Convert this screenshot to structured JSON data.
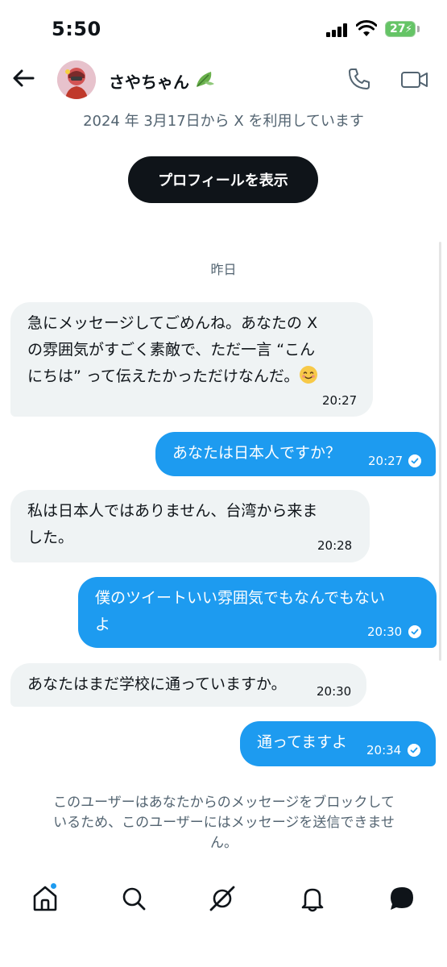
{
  "status_bar": {
    "time": "5:50",
    "battery": "27"
  },
  "header": {
    "contact_name": "さやちゃん"
  },
  "joined_text": "2024 年 3月17日から X を利用しています",
  "profile_button": "プロフィールを表示",
  "date_separator": "昨日",
  "messages": [
    {
      "direction": "in",
      "lines": [
        "急にメッセージしてごめんね。あなたの X",
        "の雰囲気がすごく素敵で、ただ一言 “こん",
        "にちは” って伝えたかっただけなんだ。"
      ],
      "time": "20:27"
    },
    {
      "direction": "out",
      "lines": [
        "あなたは日本人ですか？"
      ],
      "time": "20:27",
      "read": true
    },
    {
      "direction": "in",
      "lines": [
        "私は日本人ではありません、台湾から来ま",
        "した。"
      ],
      "time": "20:28"
    },
    {
      "direction": "out",
      "lines": [
        "僕のツイートいい雰囲気でもなんでもない",
        "よ"
      ],
      "time": "20:30",
      "read": true
    },
    {
      "direction": "in",
      "lines": [
        "あなたはまだ学校に通っていますか。"
      ],
      "time": "20:30"
    },
    {
      "direction": "out",
      "lines": [
        "通ってますよ"
      ],
      "time": "20:34",
      "read": true
    }
  ],
  "blocked_notice": {
    "line1": "このユーザーはあなたからのメッセージをブロックして",
    "line2": "いるため、このユーザーにはメッセージを送信できませ",
    "line3": "ん。"
  },
  "icons": {
    "back": "arrow-left-icon",
    "call": "phone-icon",
    "video": "video-camera-icon",
    "home": "home-icon",
    "search": "search-icon",
    "grok": "grok-icon",
    "notifications": "bell-icon",
    "messages": "message-bubble-icon"
  },
  "colors": {
    "accent": "#1d9bf0",
    "incoming_bubble": "#eff3f4",
    "muted_text": "#536471",
    "battery": "#65c466"
  }
}
